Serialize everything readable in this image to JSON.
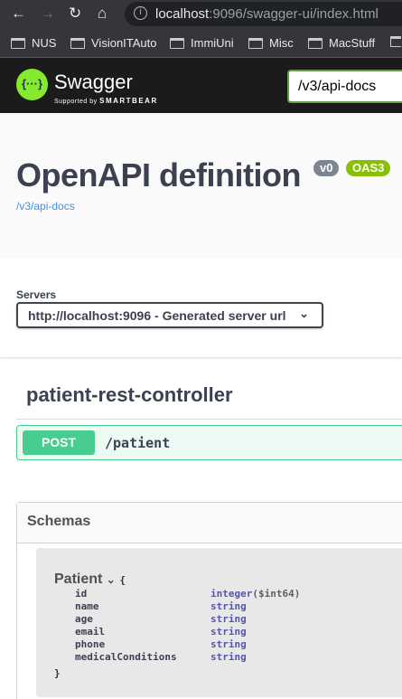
{
  "browser": {
    "url_host": "localhost",
    "url_path": ":9096/swagger-ui/index.html",
    "bookmarks": [
      "NUS",
      "VisionITAuto",
      "ImmiUni",
      "Misc",
      "MacStuff"
    ]
  },
  "header": {
    "brand": "Swagger",
    "supported_by": "Supported by",
    "smartbear": "SMARTBEAR",
    "logo_text": "{···}",
    "explore_value": "/v3/api-docs"
  },
  "info": {
    "title": "OpenAPI definition",
    "version": "v0",
    "oas": "OAS3",
    "link": "/v3/api-docs",
    "colors": {
      "version": "#7d8492",
      "oas": "#89bf04"
    }
  },
  "servers": {
    "label": "Servers",
    "selected": "http://localhost:9096 - Generated server url"
  },
  "tag": {
    "name": "patient-rest-controller"
  },
  "operation": {
    "method": "POST",
    "path": "/patient",
    "color": "#49cc90"
  },
  "schemas": {
    "title": "Schemas",
    "model": {
      "name": "Patient",
      "open_brace": "{",
      "close_brace": "}",
      "properties": [
        {
          "name": "id",
          "type": "integer",
          "format": "($int64)"
        },
        {
          "name": "name",
          "type": "string",
          "format": ""
        },
        {
          "name": "age",
          "type": "string",
          "format": ""
        },
        {
          "name": "email",
          "type": "string",
          "format": ""
        },
        {
          "name": "phone",
          "type": "string",
          "format": ""
        },
        {
          "name": "medicalConditions",
          "type": "string",
          "format": ""
        }
      ]
    }
  }
}
